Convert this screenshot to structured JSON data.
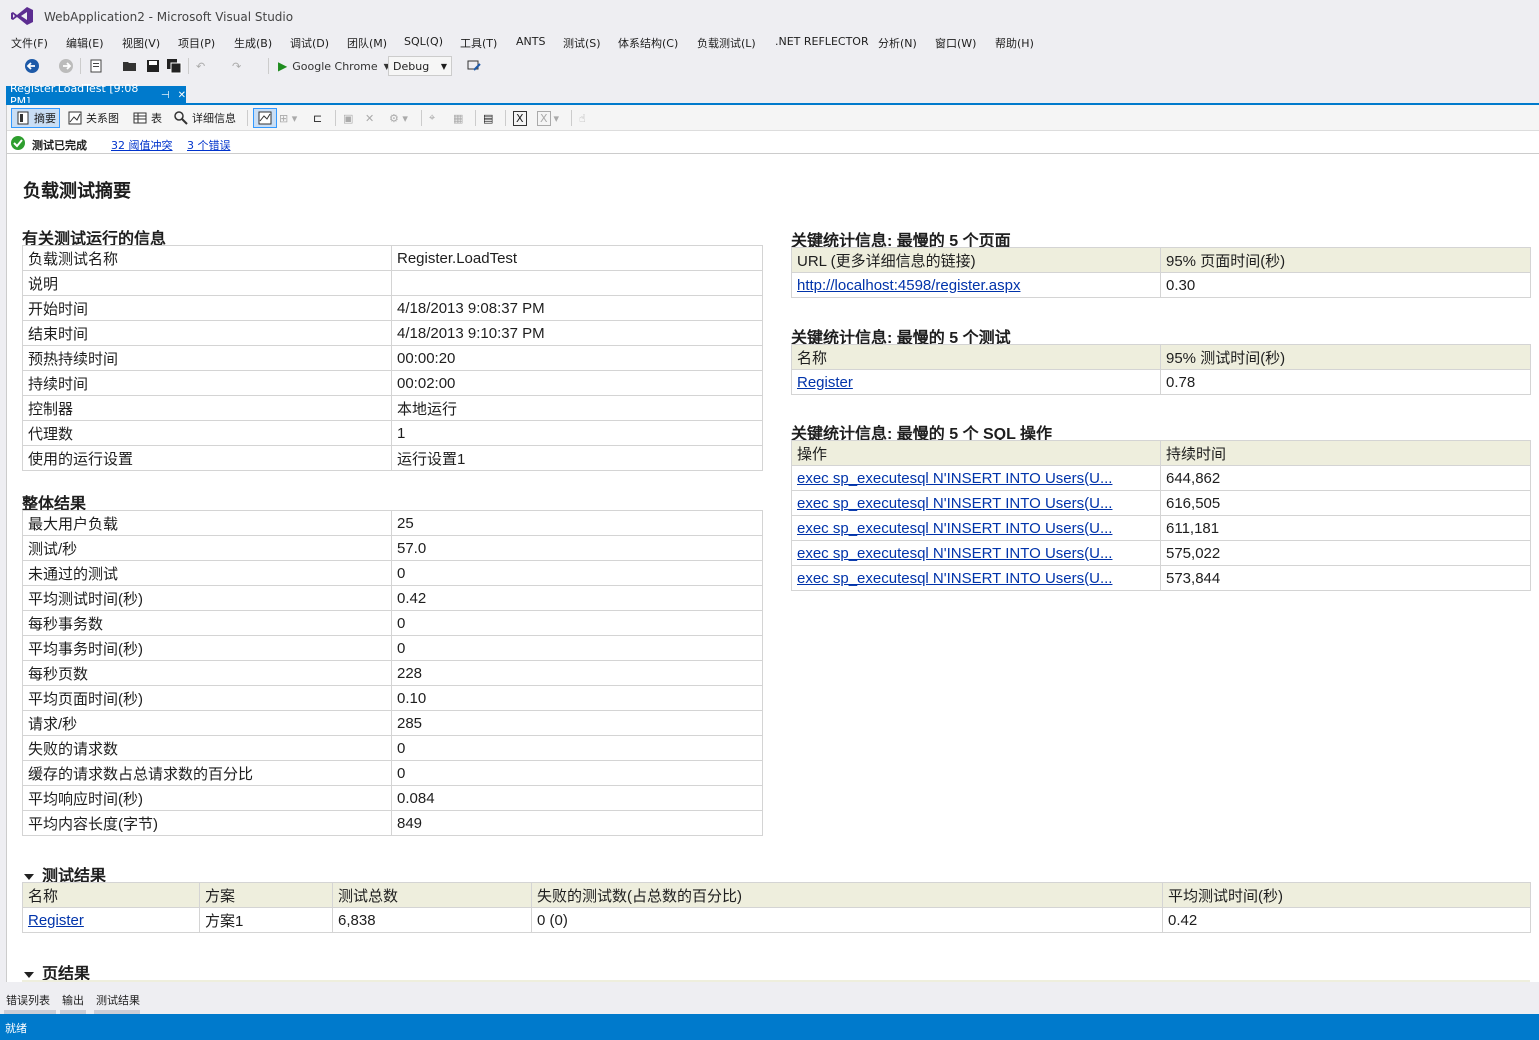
{
  "window": {
    "title": "WebApplication2 - Microsoft Visual Studio"
  },
  "menu": [
    "文件(F)",
    "编辑(E)",
    "视图(V)",
    "项目(P)",
    "生成(B)",
    "调试(D)",
    "团队(M)",
    "SQL(Q)",
    "工具(T)",
    "ANTS",
    "测试(S)",
    "体系结构(C)",
    "负载测试(L)",
    ".NET REFLECTOR",
    "分析(N)",
    "窗口(W)",
    "帮助(H)"
  ],
  "toolbar": {
    "browser": "Google Chrome",
    "config": "Debug"
  },
  "doc_tab": {
    "label": "Register.LoadTest [9:08 PM]",
    "pin": "⊣",
    "close": "✕"
  },
  "viewbar": {
    "summary": "摘要",
    "graph": "关系图",
    "table": "表",
    "details": "详细信息"
  },
  "status": {
    "done": "测试已完成",
    "threshold_link": "32 阈值冲突",
    "error_link": "3 个错误"
  },
  "report": {
    "title": "负载测试摘要",
    "run_info": {
      "title": "有关测试运行的信息",
      "rows": [
        [
          "负载测试名称",
          "Register.LoadTest"
        ],
        [
          "说明",
          ""
        ],
        [
          "开始时间",
          "4/18/2013 9:08:37 PM"
        ],
        [
          "结束时间",
          "4/18/2013 9:10:37 PM"
        ],
        [
          "预热持续时间",
          "00:00:20"
        ],
        [
          "持续时间",
          "00:02:00"
        ],
        [
          "控制器",
          "本地运行"
        ],
        [
          "代理数",
          "1"
        ],
        [
          "使用的运行设置",
          "运行设置1"
        ]
      ]
    },
    "overall": {
      "title": "整体结果",
      "rows": [
        [
          "最大用户负载",
          "25"
        ],
        [
          "测试/秒",
          "57.0"
        ],
        [
          "未通过的测试",
          "0"
        ],
        [
          "平均测试时间(秒)",
          "0.42"
        ],
        [
          "每秒事务数",
          "0"
        ],
        [
          "平均事务时间(秒)",
          "0"
        ],
        [
          "每秒页数",
          "228"
        ],
        [
          "平均页面时间(秒)",
          "0.10"
        ],
        [
          "请求/秒",
          "285"
        ],
        [
          "失败的请求数",
          "0"
        ],
        [
          "缓存的请求数占总请求数的百分比",
          "0"
        ],
        [
          "平均响应时间(秒)",
          "0.084"
        ],
        [
          "平均内容长度(字节)",
          "849"
        ]
      ]
    },
    "slow_pages": {
      "title": "关键统计信息: 最慢的  5 个页面",
      "headers": [
        "URL (更多详细信息的链接)",
        "95% 页面时间(秒)"
      ],
      "rows": [
        [
          "http://localhost:4598/register.aspx",
          "0.30"
        ]
      ]
    },
    "slow_tests": {
      "title": "关键统计信息: 最慢的  5 个测试",
      "headers": [
        "名称",
        "95% 测试时间(秒)"
      ],
      "rows": [
        [
          "Register",
          "0.78"
        ]
      ]
    },
    "slow_sql": {
      "title": "关键统计信息: 最慢的  5 个  SQL 操作",
      "headers": [
        "操作",
        "持续时间"
      ],
      "rows": [
        [
          "exec sp_executesql N'INSERT INTO Users(U...",
          "644,862"
        ],
        [
          "exec sp_executesql N'INSERT INTO Users(U...",
          "616,505"
        ],
        [
          "exec sp_executesql N'INSERT INTO Users(U...",
          "611,181"
        ],
        [
          "exec sp_executesql N'INSERT INTO Users(U...",
          "575,022"
        ],
        [
          "exec sp_executesql N'INSERT INTO Users(U...",
          "573,844"
        ]
      ]
    },
    "test_results": {
      "title": "测试结果",
      "headers": [
        "名称",
        "方案",
        "测试总数",
        "失败的测试数(占总数的百分比)",
        "平均测试时间(秒)"
      ],
      "rows": [
        [
          "Register",
          "方案1",
          "6,838",
          "0 (0)",
          "0.42"
        ]
      ]
    },
    "page_results": {
      "title": "页结果"
    }
  },
  "bottom_tabs": [
    "错误列表",
    "输出",
    "测试结果"
  ],
  "statusbar": {
    "text": "就绪"
  },
  "colors": {
    "accent": "#007acc",
    "header_bg": "#eeeedd",
    "link": "#0033aa"
  }
}
